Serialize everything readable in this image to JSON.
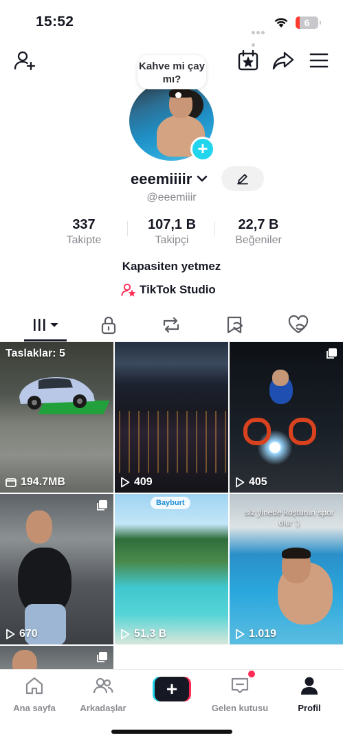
{
  "status_bar": {
    "time": "15:52",
    "battery": "6"
  },
  "profile": {
    "note": "Kahve mi çay mı?",
    "username": "eeemiiiir",
    "handle": "@eeemiiir",
    "bio": "Kapasiten yetmez",
    "studio_label": "TikTok Studio"
  },
  "stats": [
    {
      "value": "337",
      "label": "Takipte"
    },
    {
      "value": "107,1 B",
      "label": "Takipçi"
    },
    {
      "value": "22,7 B",
      "label": "Beğeniler"
    }
  ],
  "tabs": [
    "videos-grid-icon",
    "lock-icon",
    "repost-icon",
    "saved-icon",
    "liked-icon"
  ],
  "grid": {
    "drafts_label": "Taslaklar: 5",
    "tiles": [
      {
        "label": "194.7MB",
        "icon": "folder-icon"
      },
      {
        "label": "409",
        "icon": "play-icon"
      },
      {
        "label": "405",
        "icon": "play-icon"
      },
      {
        "label": "670",
        "icon": "play-icon"
      },
      {
        "label": "51,3 B",
        "icon": "play-icon",
        "location": "Bayburt"
      },
      {
        "label": "1.019",
        "icon": "play-icon",
        "caption": "siz yinede koşturun spor olur :)"
      }
    ]
  },
  "bottom_nav": {
    "home": "Ana sayfa",
    "friends": "Arkadaşlar",
    "inbox": "Gelen kutusu",
    "profile": "Profil"
  },
  "colors": {
    "accent_cyan": "#20d5ec",
    "accent_red": "#fe2c55",
    "text": "#161823",
    "muted": "#8a8b91"
  }
}
